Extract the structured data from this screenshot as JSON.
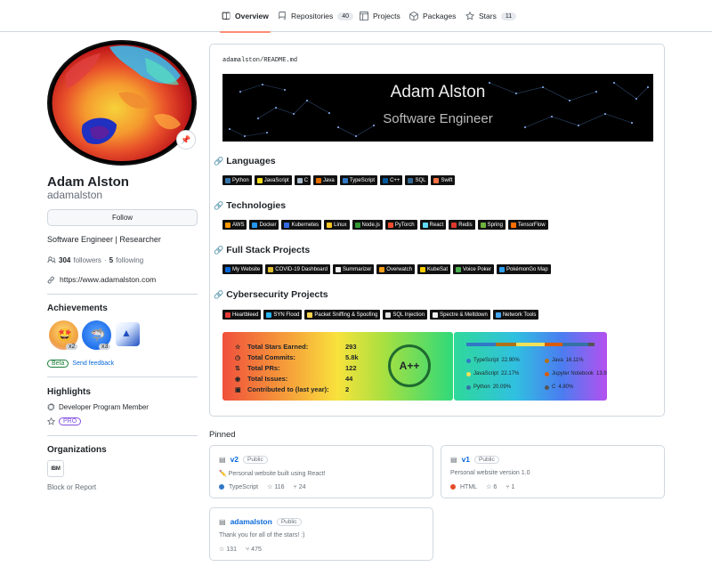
{
  "nav": {
    "tabs": [
      {
        "label": "Overview",
        "count": null
      },
      {
        "label": "Repositories",
        "count": "40"
      },
      {
        "label": "Projects",
        "count": null
      },
      {
        "label": "Packages",
        "count": null
      },
      {
        "label": "Stars",
        "count": "11"
      }
    ]
  },
  "profile": {
    "avatar_status_icon": "pushpin-icon",
    "name": "Adam Alston",
    "login": "adamalston",
    "follow_label": "Follow",
    "bio": "Software Engineer | Researcher",
    "followers_count": "304",
    "followers_label": "followers",
    "separator": "·",
    "following_count": "5",
    "following_label": "following",
    "website": "https://www.adamalston.com"
  },
  "achievements": {
    "title": "Achievements",
    "badges": [
      {
        "name": "starstruck",
        "multiplier": "x2"
      },
      {
        "name": "pull-shark",
        "multiplier": "x3"
      },
      {
        "name": "arctic-code-vault",
        "multiplier": null
      }
    ],
    "beta_label": "Beta",
    "feedback_label": "Send feedback"
  },
  "highlights": {
    "title": "Highlights",
    "items": [
      "Developer Program Member"
    ],
    "pro_label": "PRO"
  },
  "organizations": {
    "title": "Organizations",
    "orgs": [
      "IBM"
    ],
    "block_label": "Block or Report"
  },
  "readme": {
    "breadcrumb_user": "adamalston",
    "breadcrumb_sep": "/",
    "breadcrumb_file": "README.md",
    "banner_name": "Adam Alston",
    "banner_role": "Software Engineer",
    "sections": [
      {
        "title": "Languages",
        "badges": [
          {
            "label": "Python",
            "color": "#3776ab"
          },
          {
            "label": "JavaScript",
            "color": "#f7df1e"
          },
          {
            "label": "C",
            "color": "#a8b9cc"
          },
          {
            "label": "Java",
            "color": "#e76f00"
          },
          {
            "label": "TypeScript",
            "color": "#3178c6"
          },
          {
            "label": "C++",
            "color": "#00599c"
          },
          {
            "label": "SQL",
            "color": "#336791"
          },
          {
            "label": "Swift",
            "color": "#fa7343"
          }
        ]
      },
      {
        "title": "Technologies",
        "badges": [
          {
            "label": "AWS",
            "color": "#ff9900"
          },
          {
            "label": "Docker",
            "color": "#2496ed"
          },
          {
            "label": "Kubernetes",
            "color": "#326ce5"
          },
          {
            "label": "Linux",
            "color": "#fcc624"
          },
          {
            "label": "Node.js",
            "color": "#339933"
          },
          {
            "label": "PyTorch",
            "color": "#ee4c2c"
          },
          {
            "label": "React",
            "color": "#61dafb"
          },
          {
            "label": "Redis",
            "color": "#dc382d"
          },
          {
            "label": "Spring",
            "color": "#6db33f"
          },
          {
            "label": "TensorFlow",
            "color": "#ff6f00"
          }
        ]
      },
      {
        "title": "Full Stack Projects",
        "badges": [
          {
            "label": "My Website",
            "color": "#0969da"
          },
          {
            "label": "COVID-19 Dashboard",
            "color": "#e0c030"
          },
          {
            "label": "Summarizer",
            "color": "#f0f0f0"
          },
          {
            "label": "Overwatch",
            "color": "#f99e1a"
          },
          {
            "label": "KubeSat",
            "color": "#ffcc00"
          },
          {
            "label": "Voice Poker",
            "color": "#4caf50"
          },
          {
            "label": "PokémonGo Map",
            "color": "#2ea0f0"
          }
        ]
      },
      {
        "title": "Cybersecurity Projects",
        "badges": [
          {
            "label": "Heartbleed",
            "color": "#e53935"
          },
          {
            "label": "SYN Flood",
            "color": "#29b6f6"
          },
          {
            "label": "Packet Sniffing & Spoofing",
            "color": "#ffd54f"
          },
          {
            "label": "SQL Injection",
            "color": "#e0e0e0"
          },
          {
            "label": "Spectre & Meltdown",
            "color": "#eeeeee"
          },
          {
            "label": "Network Tools",
            "color": "#42a5f5"
          }
        ]
      }
    ],
    "stats": {
      "rows": [
        {
          "icon": "star-icon",
          "label": "Total Stars Earned:",
          "value": "293"
        },
        {
          "icon": "history-icon",
          "label": "Total Commits:",
          "value": "5.8k"
        },
        {
          "icon": "pull-request-icon",
          "label": "Total PRs:",
          "value": "122"
        },
        {
          "icon": "issue-icon",
          "label": "Total Issues:",
          "value": "44"
        },
        {
          "icon": "repo-icon",
          "label": "Contributed to (last year):",
          "value": "2"
        }
      ],
      "rank": "A++",
      "rank_progress": 0.85
    },
    "top_languages": [
      {
        "name": "TypeScript",
        "percent": "22.90%",
        "value": 22.9,
        "color": "#3178c6"
      },
      {
        "name": "Java",
        "percent": "16.11%",
        "value": 16.11,
        "color": "#b07219"
      },
      {
        "name": "JavaScript",
        "percent": "22.17%",
        "value": 22.17,
        "color": "#f1e05a"
      },
      {
        "name": "Jupyter Notebook",
        "percent": "13.9",
        "value": 13.9,
        "color": "#da5b0b"
      },
      {
        "name": "Python",
        "percent": "20.09%",
        "value": 20.09,
        "color": "#3572a5"
      },
      {
        "name": "C",
        "percent": "4.80%",
        "value": 4.8,
        "color": "#555555"
      }
    ]
  },
  "pinned": {
    "title": "Pinned",
    "repos": [
      {
        "name": "v2",
        "visibility": "Public",
        "description": "✏️ Personal website built using React!",
        "language": "TypeScript",
        "lang_color": "#3178c6",
        "stars": "116",
        "forks": "24"
      },
      {
        "name": "v1",
        "visibility": "Public",
        "description": "Personal website version 1.0",
        "language": "HTML",
        "lang_color": "#e34c26",
        "stars": "6",
        "forks": "1"
      },
      {
        "name": "adamalston",
        "visibility": "Public",
        "description": "Thank you for all of the stars! :)",
        "language": null,
        "lang_color": null,
        "stars": "131",
        "forks": "475"
      }
    ]
  }
}
